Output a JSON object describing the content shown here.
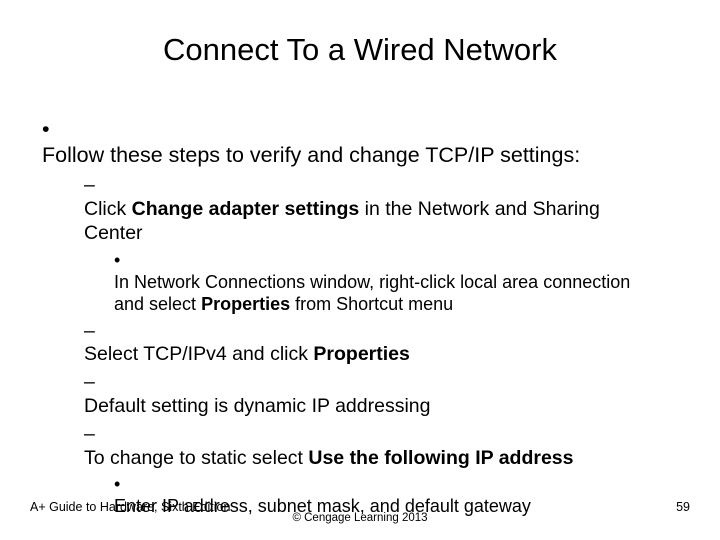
{
  "title": "Connect To a Wired Network",
  "main_intro": "Follow these steps to verify and change TCP/IP settings:",
  "s1_pre": "Click ",
  "s1_bold": "Change adapter settings",
  "s1_post": " in the Network and Sharing Center",
  "s1a_pre": "In Network Connections window, right-click local area connection and select ",
  "s1a_bold": "Properties",
  "s1a_post": " from Shortcut menu",
  "s2_pre": "Select TCP/IPv4 and click ",
  "s2_bold": "Properties",
  "s3": "Default setting is dynamic IP addressing",
  "s4_pre": "To change to static select ",
  "s4_bold": "Use the following IP address",
  "s4a": "Enter IP address, subnet mask, and default gateway",
  "footer_book": "A+ Guide to Hardware, Sixth Edition",
  "footer_copy": "© Cengage Learning  2013",
  "footer_page": "59"
}
